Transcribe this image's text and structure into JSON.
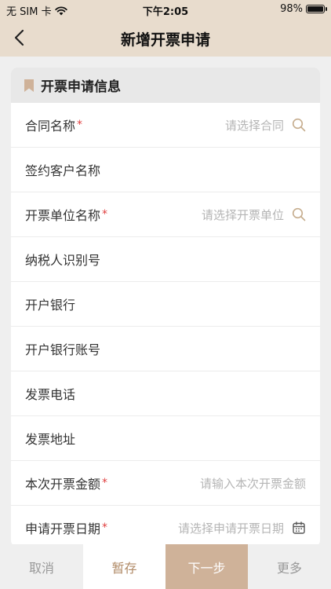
{
  "status": {
    "carrier": "无 SIM 卡",
    "time": "下午2:05",
    "battery": "98%",
    "battery_level": 0.98
  },
  "nav": {
    "title": "新增开票申请",
    "back_icon": "chevron-left-icon"
  },
  "section": {
    "title": "开票申请信息",
    "icon": "bookmark-icon",
    "accent": "#cfb299"
  },
  "fields": [
    {
      "label": "合同名称",
      "required": "*",
      "placeholder": "请选择合同",
      "icon": "search-icon"
    },
    {
      "label": "签约客户名称"
    },
    {
      "label": "开票单位名称",
      "required": "*",
      "placeholder": "请选择开票单位",
      "icon": "search-icon"
    },
    {
      "label": "纳税人识别号"
    },
    {
      "label": "开户银行"
    },
    {
      "label": "开户银行账号"
    },
    {
      "label": "发票电话"
    },
    {
      "label": "发票地址"
    },
    {
      "label": "本次开票金额",
      "required": "*",
      "placeholder": "请输入本次开票金额"
    },
    {
      "label": "申请开票日期",
      "required": "*",
      "placeholder": "请选择申请开票日期",
      "icon": "calendar-icon"
    }
  ],
  "actions": {
    "cancel": "取消",
    "save": "暂存",
    "next": "下一步",
    "more": "更多"
  },
  "colors": {
    "header_bg": "#e8dccd",
    "accent": "#cfb299",
    "save_text": "#b08a66",
    "required": "#e04040"
  }
}
